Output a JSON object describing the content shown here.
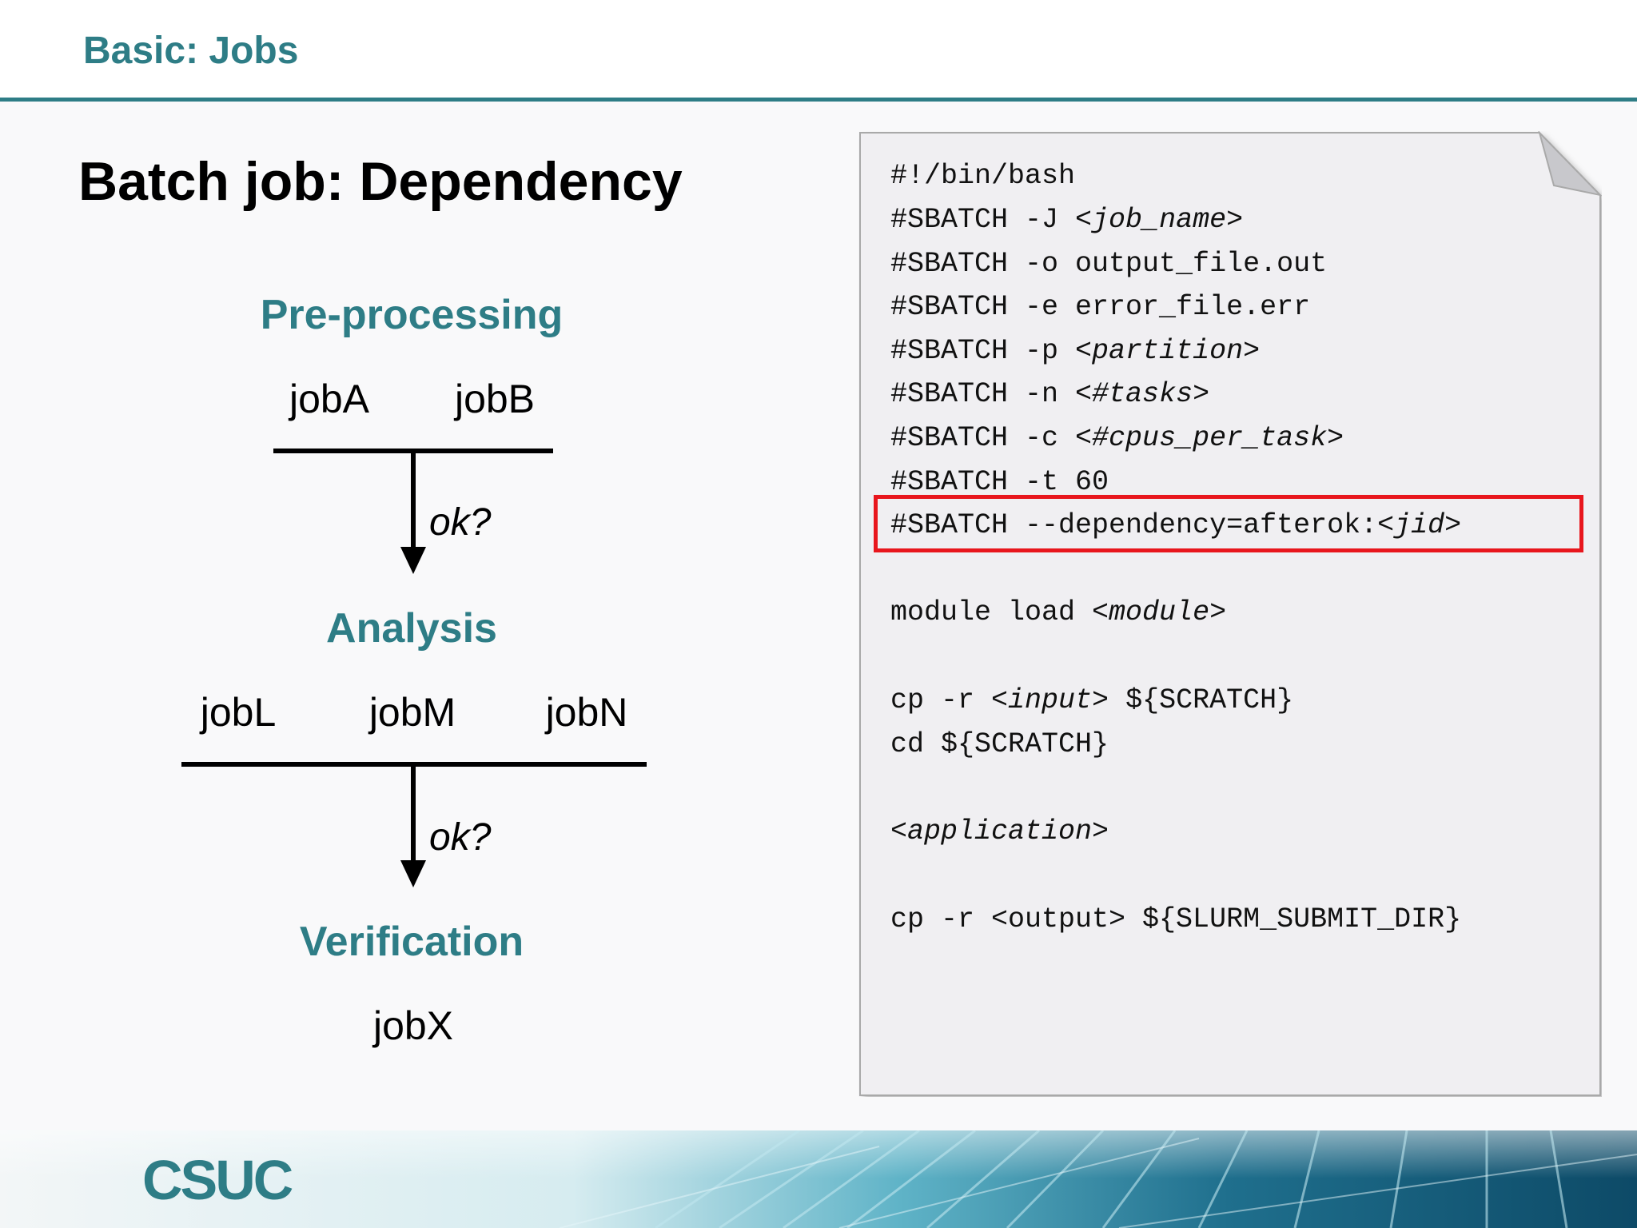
{
  "header": {
    "title": "Basic: Jobs"
  },
  "slide": {
    "title": "Batch job: Dependency"
  },
  "diagram": {
    "stage1": {
      "label": "Pre-processing",
      "jobs": [
        "jobA",
        "jobB"
      ]
    },
    "arrow1_label": "ok?",
    "stage2": {
      "label": "Analysis",
      "jobs": [
        "jobL",
        "jobM",
        "jobN"
      ]
    },
    "arrow2_label": "ok?",
    "stage3": {
      "label": "Verification",
      "jobs": [
        "jobX"
      ]
    }
  },
  "script": {
    "lines": [
      {
        "parts": [
          {
            "text": "#!/bin/bash"
          }
        ]
      },
      {
        "parts": [
          {
            "text": "#SBATCH -J "
          },
          {
            "text": "<job_name>",
            "italic": true
          }
        ]
      },
      {
        "parts": [
          {
            "text": "#SBATCH -o output_file.out"
          }
        ]
      },
      {
        "parts": [
          {
            "text": "#SBATCH -e error_file.err"
          }
        ]
      },
      {
        "parts": [
          {
            "text": "#SBATCH -p "
          },
          {
            "text": "<partition>",
            "italic": true
          }
        ]
      },
      {
        "parts": [
          {
            "text": "#SBATCH -n "
          },
          {
            "text": "<#tasks>",
            "italic": true
          }
        ]
      },
      {
        "parts": [
          {
            "text": "#SBATCH -c "
          },
          {
            "text": "<#cpus_per_task>",
            "italic": true
          }
        ]
      },
      {
        "parts": [
          {
            "text": "#SBATCH -t 60"
          }
        ]
      },
      {
        "parts": [
          {
            "text": "#SBATCH --dependency=afterok:"
          },
          {
            "text": "<jid>",
            "italic": true
          }
        ],
        "highlighted": true
      },
      {
        "parts": [
          {
            "text": "module load "
          },
          {
            "text": "<module>",
            "italic": true
          }
        ]
      },
      {
        "parts": [
          {
            "text": "cp -r "
          },
          {
            "text": "<input>",
            "italic": true
          },
          {
            "text": " ${SCRATCH}"
          }
        ]
      },
      {
        "parts": [
          {
            "text": "cd ${SCRATCH}"
          }
        ]
      },
      {
        "parts": [
          {
            "text": "<application>",
            "italic": true
          }
        ]
      },
      {
        "parts": [
          {
            "text": "cp -r <output> ${SLURM_SUBMIT_DIR}"
          }
        ]
      }
    ],
    "highlight_color": "#e8161d"
  },
  "footer": {
    "logo_text": "CSUC"
  },
  "colors": {
    "accent": "#2e7d86",
    "highlight": "#e8161d"
  }
}
